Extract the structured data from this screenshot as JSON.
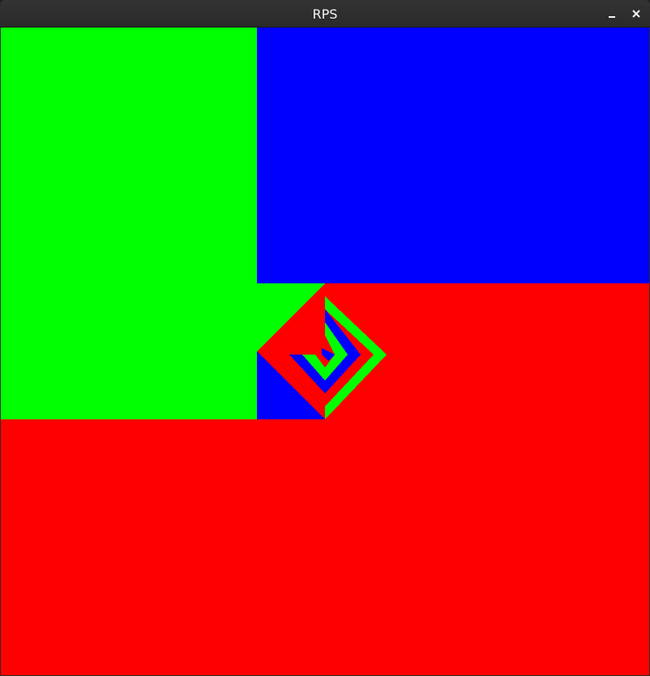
{
  "window": {
    "title": "RPS",
    "buttons": [
      {
        "name": "minimize-button",
        "icon": "minimize-icon"
      },
      {
        "name": "close-button",
        "icon": "close-icon"
      }
    ]
  },
  "game": {
    "colors": {
      "rock": "#ff0000",
      "paper": "#00ff00",
      "scissors": "#0000ff"
    }
  }
}
